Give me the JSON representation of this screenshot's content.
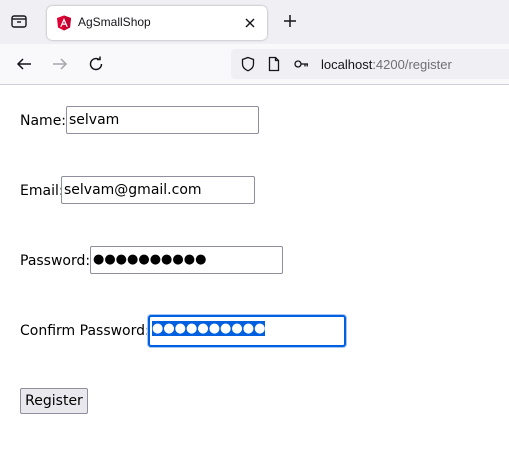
{
  "browser": {
    "tab": {
      "title": "AgSmallShop"
    },
    "url": {
      "host": "localhost",
      "path": ":4200/register"
    }
  },
  "form": {
    "name": {
      "label": "Name:",
      "value": "selvam"
    },
    "email": {
      "label": "Email:",
      "value": "selvam@gmail.com"
    },
    "password": {
      "label": "Password:",
      "masked": "●●●●●●●●●●"
    },
    "confirm_password": {
      "label": "Confirm Password:",
      "masked": "●●●●●●●●●●"
    },
    "submit_label": "Register"
  },
  "colors": {
    "selection": "#0060df",
    "focus_ring": "#0060df",
    "angular_red": "#dd0031"
  }
}
